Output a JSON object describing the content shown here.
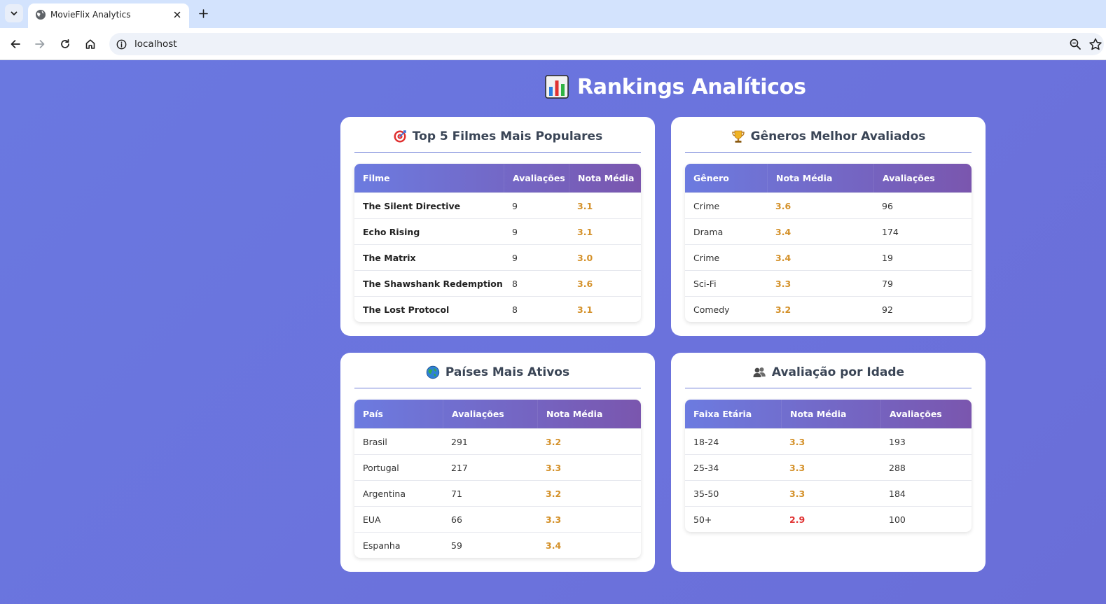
{
  "browser": {
    "tab_title": "MovieFlix Analytics",
    "url": "localhost"
  },
  "page": {
    "title": "Rankings Analíticos"
  },
  "cards": {
    "top_movies": {
      "title": "Top 5 Filmes Mais Populares",
      "headers": [
        "Filme",
        "Avaliações",
        "Nota Média"
      ],
      "rows": [
        [
          "The Silent Directive",
          "9",
          "3.1"
        ],
        [
          "Echo Rising",
          "9",
          "3.1"
        ],
        [
          "The Matrix",
          "9",
          "3.0"
        ],
        [
          "The Shawshank Redemption",
          "8",
          "3.6"
        ],
        [
          "The Lost Protocol",
          "8",
          "3.1"
        ]
      ]
    },
    "genres": {
      "title": "Gêneros Melhor Avaliados",
      "headers": [
        "Gênero",
        "Nota Média",
        "Avaliações"
      ],
      "rows": [
        [
          "Crime",
          "3.6",
          "96"
        ],
        [
          "Drama",
          "3.4",
          "174"
        ],
        [
          "Crime",
          "3.4",
          "19"
        ],
        [
          "Sci-Fi",
          "3.3",
          "79"
        ],
        [
          "Comedy",
          "3.2",
          "92"
        ]
      ]
    },
    "countries": {
      "title": "Países Mais Ativos",
      "headers": [
        "País",
        "Avaliações",
        "Nota Média"
      ],
      "rows": [
        [
          "Brasil",
          "291",
          "3.2"
        ],
        [
          "Portugal",
          "217",
          "3.3"
        ],
        [
          "Argentina",
          "71",
          "3.2"
        ],
        [
          "EUA",
          "66",
          "3.3"
        ],
        [
          "Espanha",
          "59",
          "3.4"
        ]
      ]
    },
    "age": {
      "title": "Avaliação por Idade",
      "headers": [
        "Faixa Etária",
        "Nota Média",
        "Avaliações"
      ],
      "rows": [
        [
          "18-24",
          "3.3",
          "193"
        ],
        [
          "25-34",
          "3.3",
          "288"
        ],
        [
          "35-50",
          "3.3",
          "184"
        ],
        [
          "50+",
          "2.9",
          "100"
        ]
      ]
    }
  },
  "colors": {
    "background": "#6a78df",
    "rating": "#d4912a",
    "rating_low": "#e03131",
    "header_gradient_start": "#6c7be0",
    "header_gradient_end": "#7a56ae"
  }
}
